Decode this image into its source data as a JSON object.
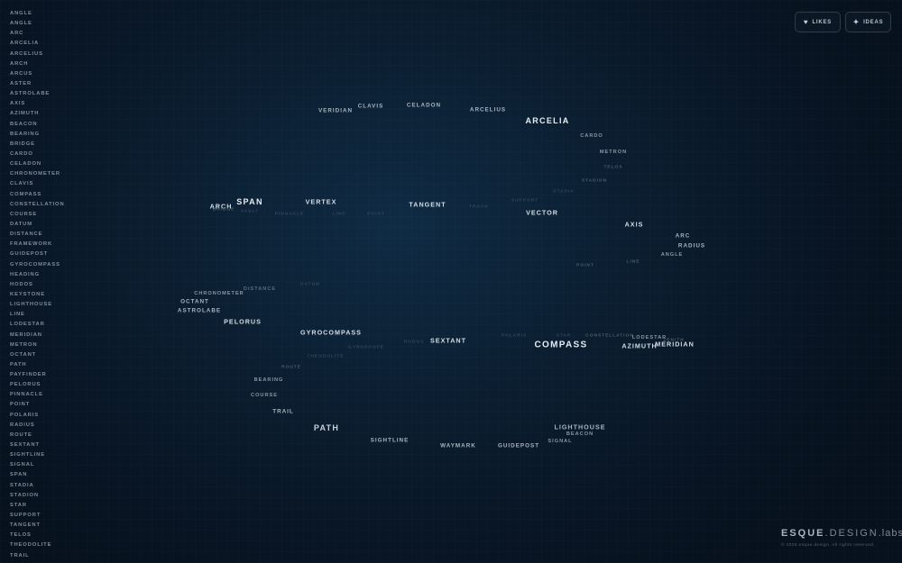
{
  "sidebar": {
    "items": [
      "ANGLE",
      "ANGLE",
      "ARC",
      "ARCELIA",
      "ARCELIUS",
      "ARCH",
      "ARCUS",
      "ASTER",
      "ASTROLABE",
      "AXIS",
      "AZIMUTH",
      "BEACON",
      "BEARING",
      "BRIDGE",
      "CARDO",
      "CELADON",
      "CHRONOMETER",
      "CLAVIS",
      "COMPASS",
      "CONSTELLATION",
      "COURSE",
      "DATUM",
      "DISTANCE",
      "FRAMEWORK",
      "GUIDEPOST",
      "GYROCOMPASS",
      "HEADING",
      "HODOS",
      "KEYSTONE",
      "LIGHTHOUSE",
      "LINE",
      "LODESTAR",
      "MERIDIAN",
      "METRON",
      "OCTANT",
      "PATH",
      "PAYFINDER",
      "PELORUS",
      "PINNACLE",
      "POINT",
      "POLARIS",
      "RADIUS",
      "ROUTE",
      "SEXTANT",
      "SIGHTLINE",
      "SIGNAL",
      "SPAN",
      "STADIA",
      "STADION",
      "STAR",
      "SUPPORT",
      "TANGENT",
      "TELOS",
      "THEODOLITE",
      "TRAIL"
    ]
  },
  "header": {
    "likes_label": "LIKES",
    "ideas_label": "IDEAS",
    "likes_icon": "heart-icon",
    "ideas_icon": "sparkle-icon"
  },
  "cloud": {
    "words": [
      "VERIDIAN",
      "CLAVIS",
      "CELADON",
      "ARCELIUS",
      "ARCELIA",
      "CARDO",
      "METRON",
      "TELOS",
      "STADION",
      "STADIA",
      "ARCH",
      "BRIDGE",
      "SPAN",
      "VAULT",
      "PINNACLE",
      "VERTEX",
      "LINE",
      "POINT",
      "TANGENT",
      "TRACK",
      "SUPPORT",
      "VECTOR",
      "AXIS",
      "ARC",
      "RADIUS",
      "ANGLE",
      "POINT",
      "LINE",
      "DISTANCE",
      "DATUM",
      "CHRONOMETER",
      "OCTANT",
      "ASTROLABE",
      "PELORUS",
      "GYROCOMPASS",
      "GYROSCOPE",
      "THEODOLITE",
      "SEXTANT",
      "HODOS",
      "ROUTE",
      "BEARING",
      "COURSE",
      "TRAIL",
      "POLARIS",
      "STAR",
      "CONSTELLATION",
      "COMPASS",
      "LODESTAR",
      "ZENITH",
      "AZIMUTH",
      "MERIDIAN",
      "PATH",
      "SIGHTLINE",
      "WAYMARK",
      "GUIDEPOST",
      "LIGHTHOUSE",
      "BEACON",
      "SIGNAL"
    ]
  },
  "footer": {
    "brand_main": "ESQUE",
    "brand_mid": ".DESIGN",
    "brand_labs": ".labs",
    "copyright": "© 2025 esque.design. All rights reserved."
  },
  "colors": {
    "background": "#0b1d2f",
    "text_primary": "#e6edf3",
    "text_muted": "#7f8b98"
  }
}
